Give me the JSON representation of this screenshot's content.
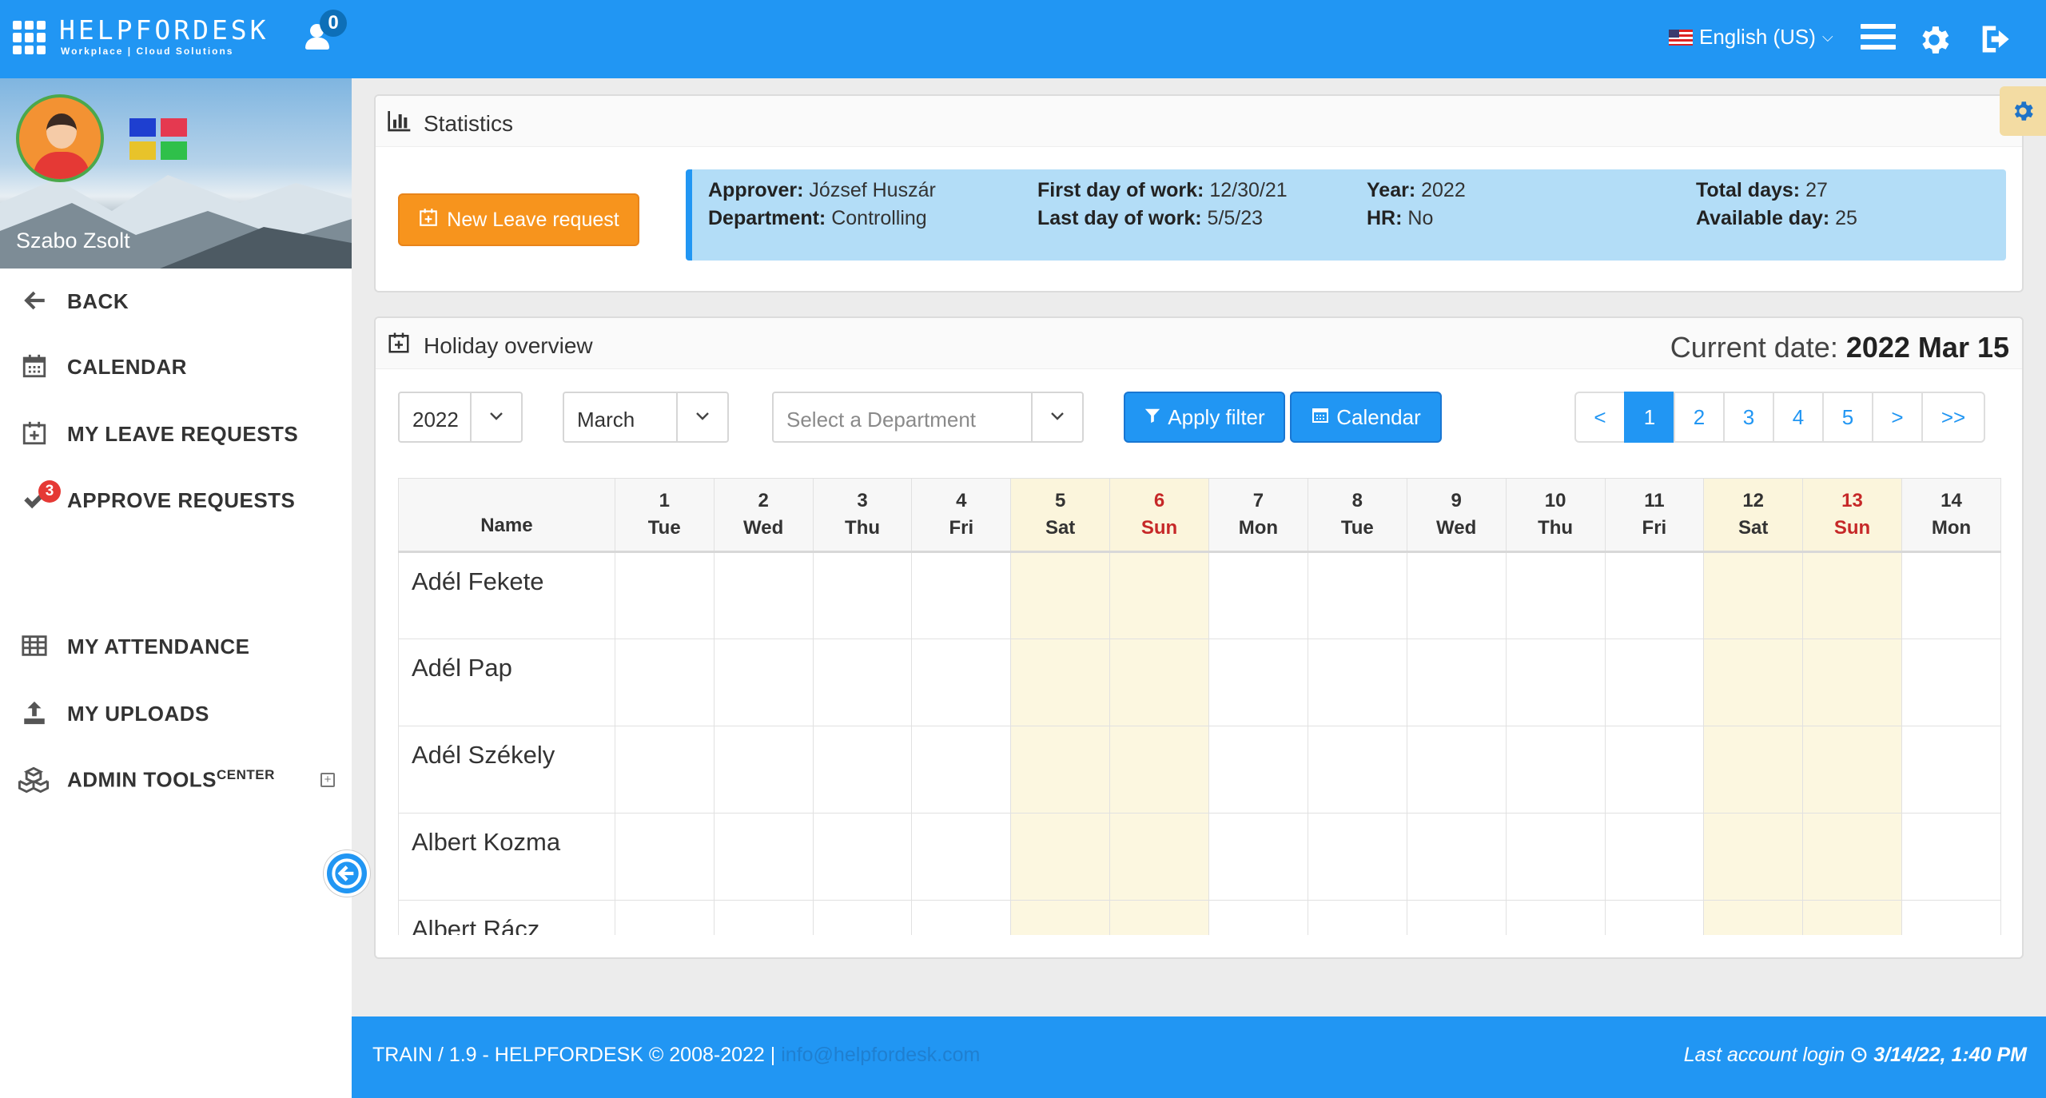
{
  "brand": {
    "name": "HELPFORDESK",
    "tagline": "Workplace | Cloud Solutions"
  },
  "header": {
    "notifications": "0",
    "language": "English (US)"
  },
  "profile": {
    "name": "Szabo Zsolt"
  },
  "sidebar": {
    "items": [
      {
        "label": "BACK",
        "icon": "arrow-left-icon"
      },
      {
        "label": "CALENDAR",
        "icon": "calendar-icon"
      },
      {
        "label": "MY LEAVE REQUESTS",
        "icon": "calendar-plus-icon"
      },
      {
        "label": "APPROVE REQUESTS",
        "icon": "check-icon",
        "badge": "3"
      },
      {
        "label": "MY ATTENDANCE",
        "icon": "table-icon"
      },
      {
        "label": "MY UPLOADS",
        "icon": "upload-icon"
      },
      {
        "label": "ADMIN TOOLS",
        "sup": "CENTER",
        "icon": "cubes-icon"
      }
    ]
  },
  "statistics": {
    "title": "Statistics",
    "new_leave_label": "New Leave request",
    "approver_label": "Approver:",
    "approver": "József Huszár",
    "department_label": "Department:",
    "department": "Controlling",
    "first_day_label": "First day of work:",
    "first_day": "12/30/21",
    "last_day_label": "Last day of work:",
    "last_day": "5/5/23",
    "year_label": "Year:",
    "year": "2022",
    "hr_label": "HR:",
    "hr": "No",
    "total_label": "Total days:",
    "total": "27",
    "available_label": "Available day:",
    "available": "25"
  },
  "holiday": {
    "title": "Holiday overview",
    "current_date_label": "Current date:",
    "current_date": "2022 Mar 15",
    "filters": {
      "year": "2022",
      "month": "March",
      "department_placeholder": "Select a Department"
    },
    "apply_label": "Apply filter",
    "calendar_label": "Calendar",
    "pager": [
      "<",
      "1",
      "2",
      "3",
      "4",
      "5",
      ">",
      ">>"
    ],
    "pager_active": "1",
    "name_header": "Name",
    "days": [
      {
        "d": "1",
        "w": "Tue"
      },
      {
        "d": "2",
        "w": "Wed"
      },
      {
        "d": "3",
        "w": "Thu"
      },
      {
        "d": "4",
        "w": "Fri"
      },
      {
        "d": "5",
        "w": "Sat"
      },
      {
        "d": "6",
        "w": "Sun"
      },
      {
        "d": "7",
        "w": "Mon"
      },
      {
        "d": "8",
        "w": "Tue"
      },
      {
        "d": "9",
        "w": "Wed"
      },
      {
        "d": "10",
        "w": "Thu"
      },
      {
        "d": "11",
        "w": "Fri"
      },
      {
        "d": "12",
        "w": "Sat"
      },
      {
        "d": "13",
        "w": "Sun"
      },
      {
        "d": "14",
        "w": "Mon"
      }
    ],
    "employees": [
      "Adél Fekete",
      "Adél Pap",
      "Adél Székely",
      "Albert Kozma",
      "Albert Rácz"
    ]
  },
  "footer": {
    "text": "TRAIN / 1.9 - HELPFORDESK © 2008-2022 |",
    "email": "info@helpfordesk.com",
    "last_login_label": "Last account login",
    "last_login": "3/14/22, 1:40 PM"
  },
  "colors": {
    "primary": "#2196f3",
    "accent": "#f7941d",
    "weekend": "#fcf7e0",
    "sunday_text": "#c62828"
  }
}
